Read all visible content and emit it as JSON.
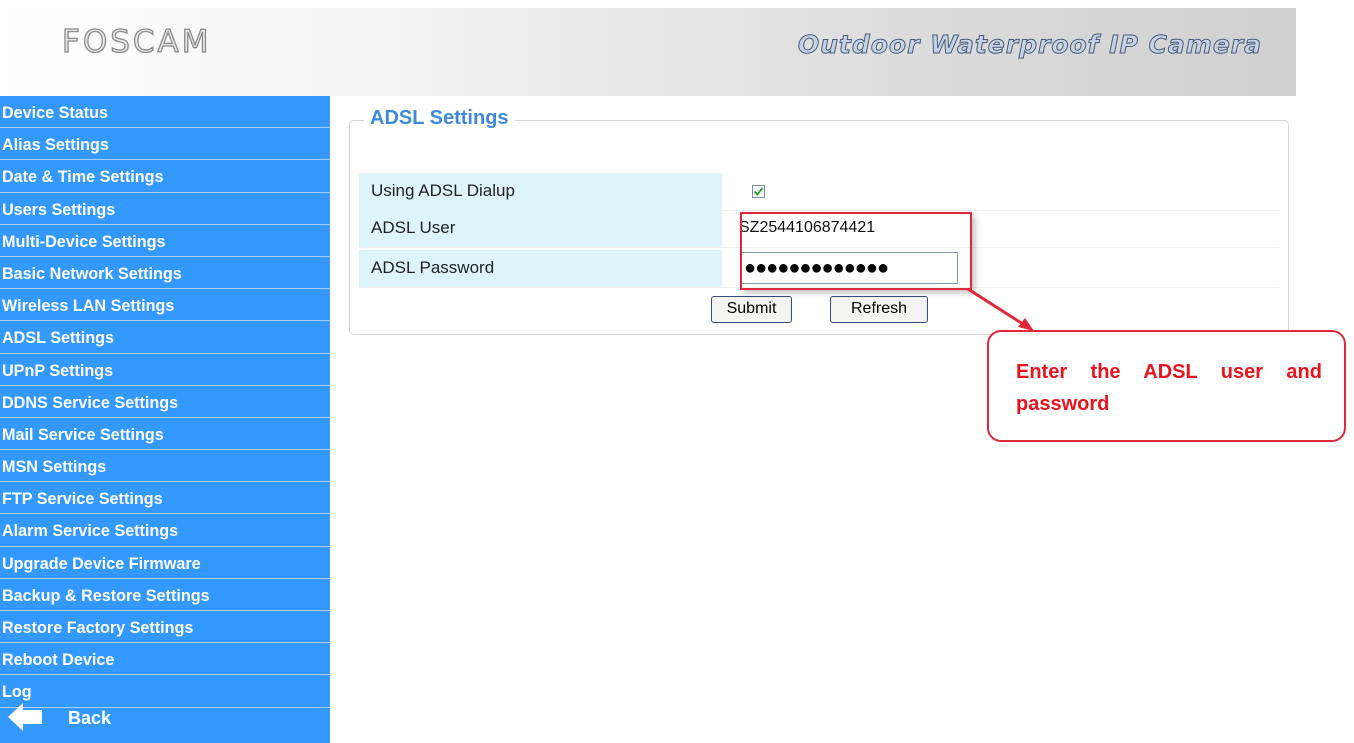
{
  "header": {
    "logo": "FOSCAM",
    "product_title": "Outdoor Waterproof IP Camera"
  },
  "sidebar": {
    "items": [
      {
        "label": "Device Status"
      },
      {
        "label": "Alias Settings"
      },
      {
        "label": "Date & Time Settings"
      },
      {
        "label": "Users Settings"
      },
      {
        "label": "Multi-Device Settings"
      },
      {
        "label": "Basic Network Settings"
      },
      {
        "label": "Wireless LAN Settings"
      },
      {
        "label": "ADSL Settings"
      },
      {
        "label": "UPnP Settings"
      },
      {
        "label": "DDNS Service Settings"
      },
      {
        "label": "Mail Service Settings"
      },
      {
        "label": "MSN Settings"
      },
      {
        "label": "FTP Service Settings"
      },
      {
        "label": "Alarm Service Settings"
      },
      {
        "label": "Upgrade Device Firmware"
      },
      {
        "label": "Backup & Restore Settings"
      },
      {
        "label": "Restore Factory Settings"
      },
      {
        "label": "Reboot Device"
      },
      {
        "label": "Log"
      }
    ],
    "back_label": "Back",
    "back_icon": "back-arrow-icon"
  },
  "adsl": {
    "title": "ADSL Settings",
    "dialup_label": "Using ADSL Dialup",
    "dialup_checked": true,
    "user_label": "ADSL User",
    "user_value": "SZ2544106874421",
    "password_label": "ADSL Password",
    "password_mask": "●●●●●●●●●●●●●",
    "submit_label": "Submit",
    "refresh_label": "Refresh"
  },
  "annotation": {
    "text": "Enter the ADSL user and password",
    "color": "#e0283a"
  },
  "colors": {
    "sidebar_bg": "#3399ff",
    "label_bg": "#ddf4fb",
    "legend": "#3d8ad8"
  }
}
